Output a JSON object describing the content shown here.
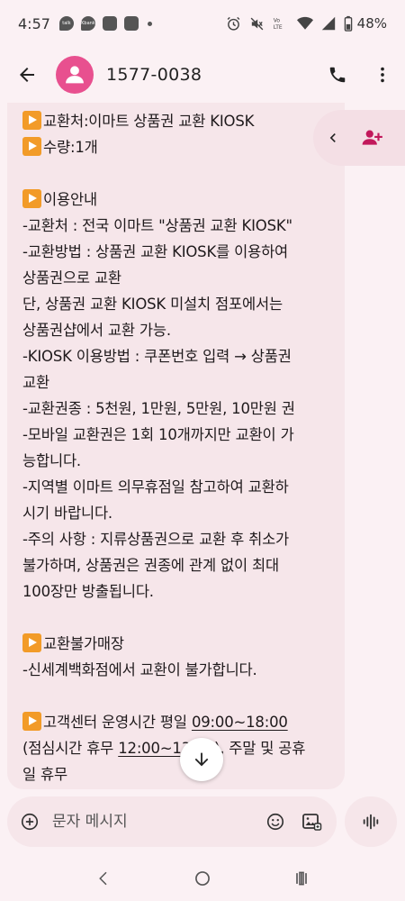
{
  "status_bar": {
    "time": "4:57",
    "notif_1": "talk",
    "notif_2": "Kbank",
    "battery_pct": "48%",
    "lte_label": "Vo LTE"
  },
  "app_bar": {
    "title": "1577-0038"
  },
  "message": {
    "lines": [
      {
        "emoji": true,
        "text": "교환처:이마트 상품권 교환 KIOSK"
      },
      {
        "emoji": true,
        "text": "수량:1개"
      },
      {
        "text": ""
      },
      {
        "emoji": true,
        "text": "이용안내"
      },
      {
        "text": "-교환처 : 전국 이마트 \"상품권 교환 KIOSK\""
      },
      {
        "text": "-교환방법 : 상품권 교환 KIOSK를 이용하여"
      },
      {
        "text": "상품권으로 교환"
      },
      {
        "text": "단, 상품권 교환 KIOSK 미설치 점포에서는"
      },
      {
        "text": "상품권샵에서 교환 가능."
      },
      {
        "text": "-KIOSK 이용방법 : 쿠폰번호 입력 → 상품권"
      },
      {
        "text": "교환"
      },
      {
        "text": "-교환권종 : 5천원, 1만원, 5만원, 10만원 권"
      },
      {
        "text": "-모바일 교환권은 1회 10개까지만 교환이 가"
      },
      {
        "text": "능합니다."
      },
      {
        "text": "-지역별 이마트 의무휴점일 참고하여 교환하"
      },
      {
        "text": "시기 바랍니다."
      },
      {
        "text": "-주의 사항 : 지류상품권으로 교환 후 취소가"
      },
      {
        "text": "불가하며, 상품권은 권종에 관계 없이 최대"
      },
      {
        "text": "100장만 방출됩니다."
      },
      {
        "text": ""
      },
      {
        "emoji": true,
        "text": "교환불가매장"
      },
      {
        "text": "-신세계백화점에서 교환이 불가합니다."
      },
      {
        "text": ""
      },
      {
        "emoji": true,
        "parts": [
          "고객센터 운영시간 평일 ",
          "09:00~18:00",
          ""
        ]
      },
      {
        "parts": [
          "(점심시간 휴무 ",
          "12:00~13:00",
          "), 주말 및 공휴"
        ]
      },
      {
        "text": "일 휴무"
      }
    ]
  },
  "compose": {
    "placeholder": "문자 메시지"
  },
  "icons": {
    "back": "arrow-left-icon",
    "avatar": "person-icon",
    "call": "phone-icon",
    "menu": "more-vert-icon",
    "collapse": "chevron-left-icon",
    "add_contact": "person-add-icon",
    "scroll": "arrow-down-icon",
    "attach": "plus-circle-icon",
    "emoji": "smiley-icon",
    "gallery": "image-gallery-icon",
    "voice": "voice-wave-icon"
  },
  "colors": {
    "accent": "#c2185b",
    "avatar_bg": "#e8508f",
    "bubble_bg": "#f6e6ea",
    "emoji_orange": "#f29b28"
  }
}
